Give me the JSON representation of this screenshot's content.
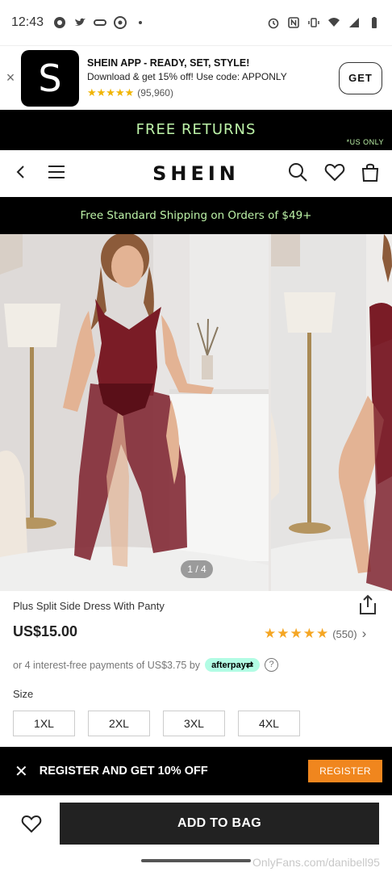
{
  "status_bar": {
    "time": "12:43"
  },
  "app_banner": {
    "close": "×",
    "logo_letter": "S",
    "title": "SHEIN APP - READY, SET, STYLE!",
    "subtitle": "Download & get 15% off! Use code: APPONLY",
    "stars": "★★★★★",
    "rating_count": "(95,960)",
    "get_label": "GET"
  },
  "promo": {
    "free_returns": "FREE RETURNS",
    "us_only": "*US ONLY"
  },
  "nav": {
    "logo": "SHEIN"
  },
  "shipping_bar": {
    "text": "Free Standard Shipping on Orders of $49+"
  },
  "gallery": {
    "counter": "1 / 4"
  },
  "product": {
    "title": "Plus Split Side Dress With Panty",
    "price": "US$15.00",
    "rating_stars": "★★★★★",
    "rating_count": "(550)",
    "rating_chevron": "›",
    "afterpay_text": "or 4 interest-free payments of US$3.75 by",
    "afterpay_badge": "afterpay⇄",
    "help": "?"
  },
  "size": {
    "label": "Size",
    "options": [
      "1XL",
      "2XL",
      "3XL",
      "4XL"
    ]
  },
  "register_bar": {
    "close": "✕",
    "text": "REGISTER AND GET 10% OFF",
    "button": "REGISTER"
  },
  "bottom_bar": {
    "add_to_bag": "ADD TO BAG"
  },
  "watermark": "OnlyFans.com/danibell95",
  "colors": {
    "promo_green": "#bdf3a8",
    "register_orange": "#f0861e",
    "star_gold": "#f5a623",
    "afterpay_mint": "#b2fce4"
  }
}
